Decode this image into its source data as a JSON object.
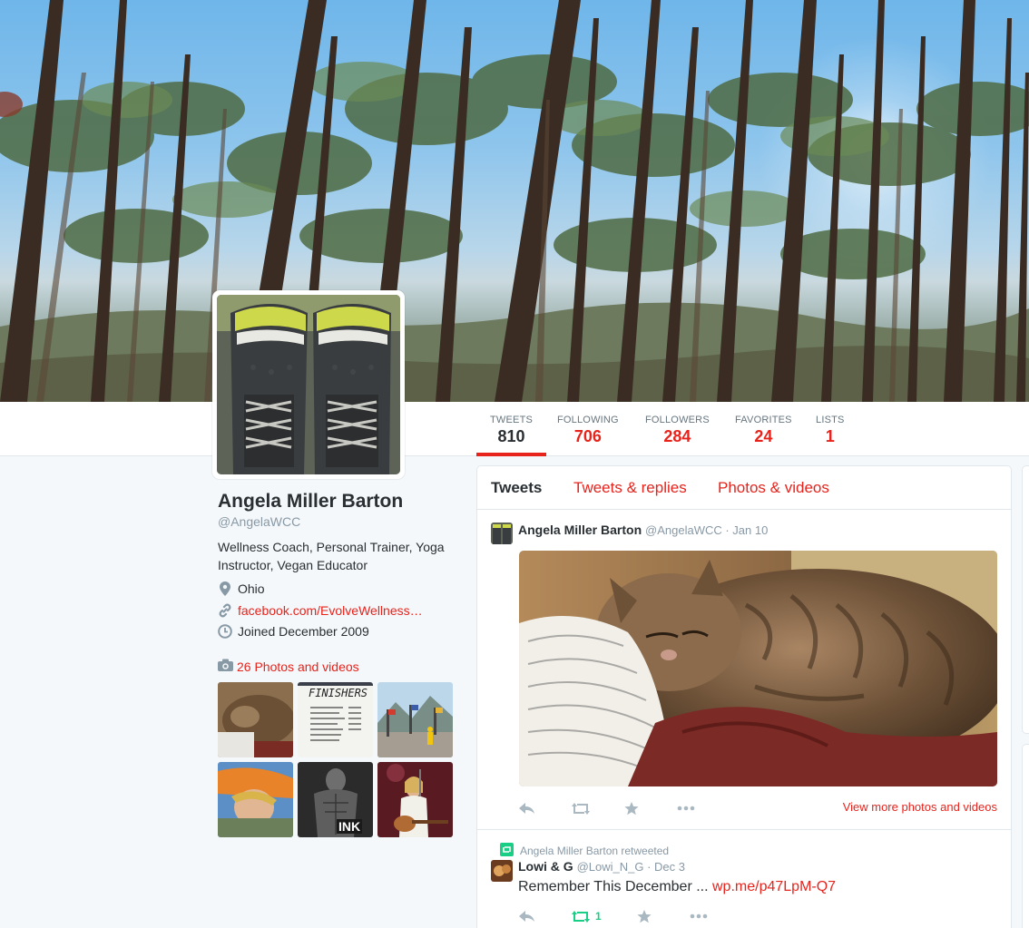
{
  "profile": {
    "name": "Angela Miller Barton",
    "handle": "@AngelaWCC",
    "bio": "Wellness Coach, Personal Trainer, Yoga Instructor, Vegan Educator",
    "location": "Ohio",
    "website": "facebook.com/EvolveWellness…",
    "joined": "Joined December 2009",
    "photos_link": "26 Photos and videos"
  },
  "stats": [
    {
      "label": "TWEETS",
      "value": "810"
    },
    {
      "label": "FOLLOWING",
      "value": "706"
    },
    {
      "label": "FOLLOWERS",
      "value": "284"
    },
    {
      "label": "FAVORITES",
      "value": "24"
    },
    {
      "label": "LISTS",
      "value": "1"
    }
  ],
  "tabs": [
    "Tweets",
    "Tweets & replies",
    "Photos & videos"
  ],
  "thumb_texts": {
    "finishers": "FINISHERS",
    "ink": "INK"
  },
  "tweets": [
    {
      "name": "Angela Miller Barton",
      "meta": "@AngelaWCC · Jan 10",
      "view_more": "View more photos and videos"
    },
    {
      "retweet_line": "Angela Miller Barton retweeted",
      "name": "Lowi & G",
      "meta": "@Lowi_N_G · Dec 3",
      "text": "Remember This December ... ",
      "link": "wp.me/p47LpM-Q7",
      "retweet_count": "1"
    }
  ],
  "colors": {
    "accent": "#e8231c",
    "text": "#292f33",
    "muted": "#8899a6",
    "retweet_green": "#19cf86"
  },
  "icons": [
    "reply-icon",
    "retweet-icon",
    "favorite-star-icon",
    "more-icon",
    "location-pin-icon",
    "link-icon",
    "calendar-icon",
    "camera-icon"
  ]
}
